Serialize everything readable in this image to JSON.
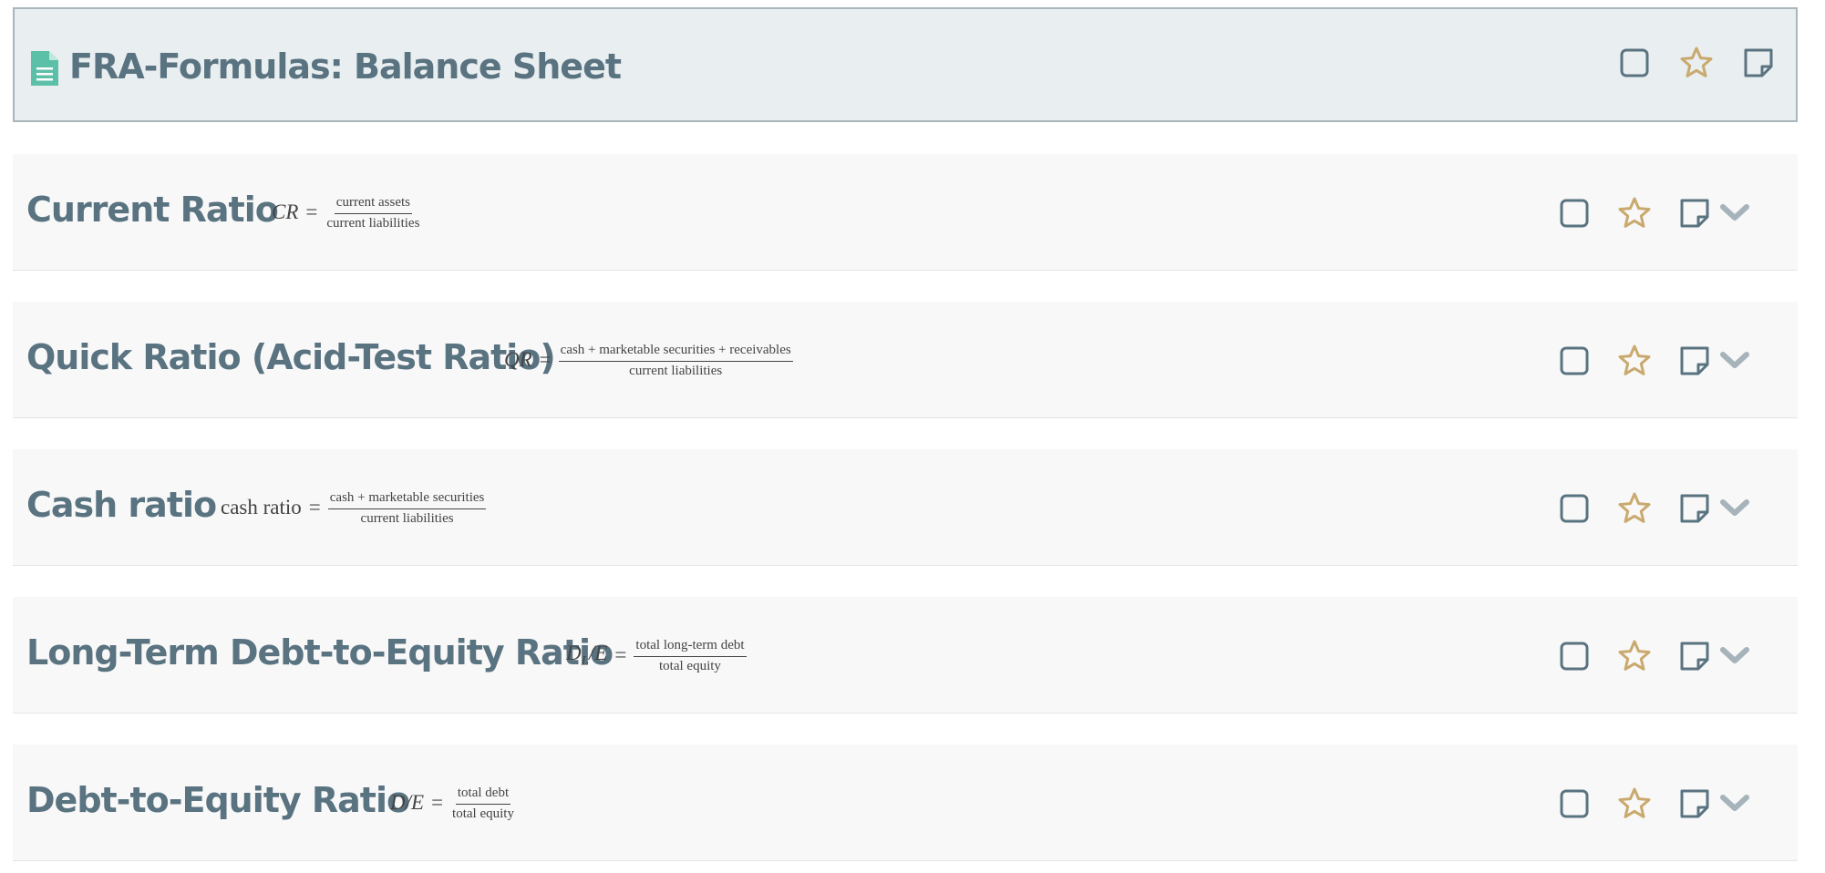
{
  "header": {
    "title": "FRA-Formulas: Balance Sheet",
    "icon": "document-icon"
  },
  "colors": {
    "title": "#5a7381",
    "header_bg": "#e9eef0",
    "row_bg": "#f8f8f8",
    "star": "#c9a96e",
    "icon_outline": "#5a7381",
    "chevron": "#a7b3bb",
    "doc_icon": "#5cc0a8"
  },
  "row_icons": [
    "checkbox-icon",
    "star-icon",
    "note-icon",
    "chevron-down-icon"
  ],
  "formulas": [
    {
      "title": "Current Ratio",
      "lhs": "CR",
      "eq": "=",
      "numerator": "current assets",
      "denominator": "current liabilities"
    },
    {
      "title": "Quick Ratio (Acid-Test Ratio)",
      "lhs": "QR",
      "eq": "=",
      "numerator": "cash + marketable securities + receivables",
      "denominator": "current liabilities"
    },
    {
      "title": "Cash ratio",
      "lhs": "cash ratio",
      "eq": "=",
      "numerator": "cash + marketable securities",
      "denominator": "current liabilities"
    },
    {
      "title": "Long-Term Debt-to-Equity Ratio",
      "lhs_main": "D",
      "lhs_sub": "L",
      "lhs_rest": "/E",
      "eq": "=",
      "numerator": "total long-term debt",
      "denominator": "total equity"
    },
    {
      "title": "Debt-to-Equity Ratio",
      "lhs": "D/E",
      "eq": "=",
      "numerator": "total debt",
      "denominator": "total equity"
    }
  ]
}
